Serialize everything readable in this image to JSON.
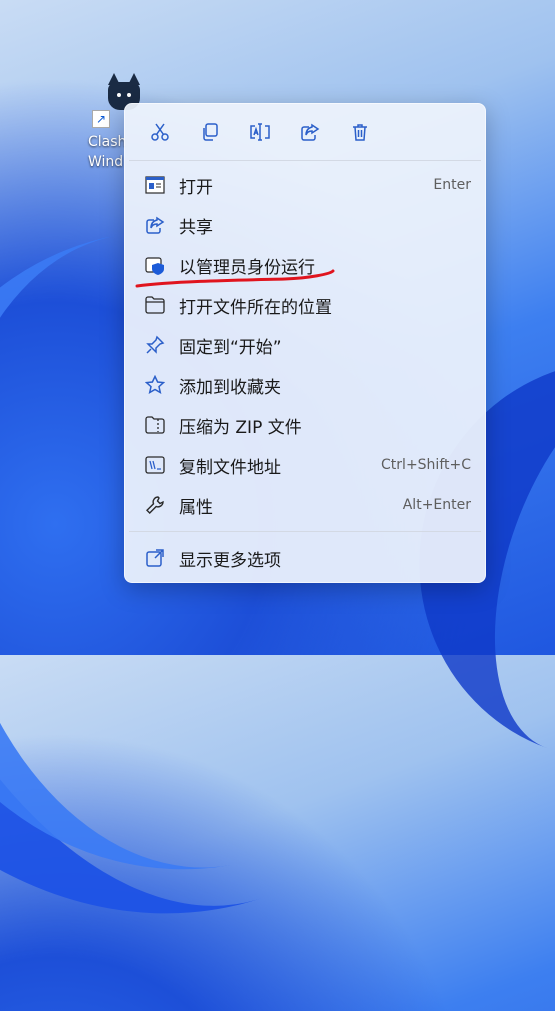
{
  "desktop": {
    "shortcut_label": "Clash\nWind"
  },
  "toolbar": [
    {
      "name": "cut-button",
      "icon": "scissors-icon"
    },
    {
      "name": "copy-button",
      "icon": "copy-icon"
    },
    {
      "name": "rename-button",
      "icon": "rename-icon"
    },
    {
      "name": "share-button",
      "icon": "share-icon"
    },
    {
      "name": "delete-button",
      "icon": "trash-icon"
    }
  ],
  "menu": {
    "items": [
      {
        "label": "打开",
        "shortcut": "Enter",
        "icon": "open-window-icon"
      },
      {
        "label": "共享",
        "shortcut": "",
        "icon": "share-icon"
      },
      {
        "label": "以管理员身份运行",
        "shortcut": "",
        "icon": "shield-icon"
      },
      {
        "label": "打开文件所在的位置",
        "shortcut": "",
        "icon": "folder-icon"
      },
      {
        "label": "固定到“开始”",
        "shortcut": "",
        "icon": "pin-icon"
      },
      {
        "label": "添加到收藏夹",
        "shortcut": "",
        "icon": "star-icon"
      },
      {
        "label": "压缩为 ZIP 文件",
        "shortcut": "",
        "icon": "zip-icon"
      },
      {
        "label": "复制文件地址",
        "shortcut": "Ctrl+Shift+C",
        "icon": "path-icon"
      },
      {
        "label": "属性",
        "shortcut": "Alt+Enter",
        "icon": "wrench-icon"
      }
    ],
    "more_label": "显示更多选项"
  },
  "colors": {
    "accent": "#2b5fc9",
    "annotation": "#e0141e"
  }
}
